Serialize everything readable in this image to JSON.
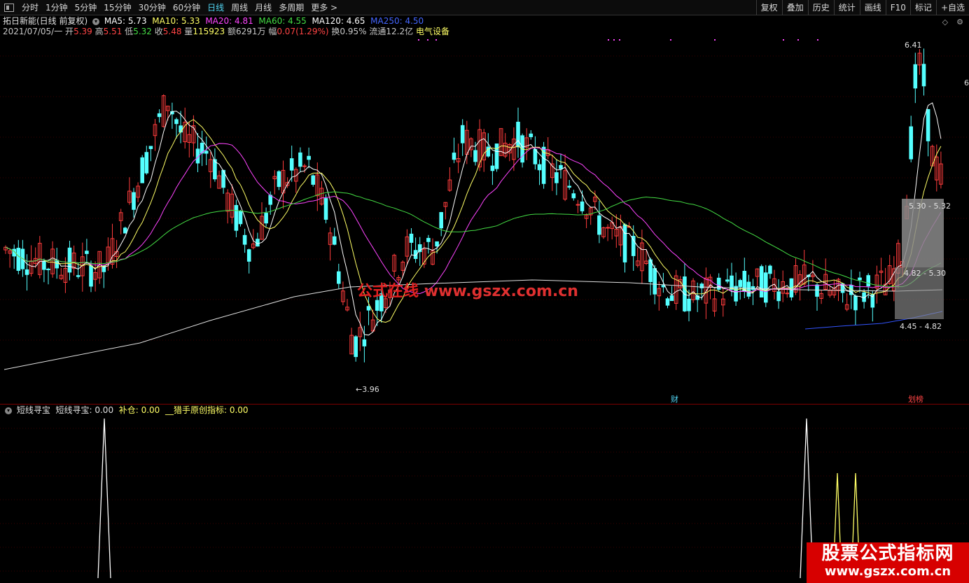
{
  "toolbar": {
    "periods": [
      "分时",
      "1分钟",
      "5分钟",
      "15分钟",
      "30分钟",
      "60分钟",
      "日线",
      "周线",
      "月线",
      "多周期",
      "更多 >"
    ],
    "active_period": "日线",
    "right_buttons": [
      "复权",
      "叠加",
      "历史",
      "统计",
      "画线",
      "F10",
      "标记",
      "+自选"
    ]
  },
  "stock": {
    "name": "拓日新能(日线 前复权)",
    "ma": [
      {
        "label": "MA5: 5.73",
        "color": "#ffffff"
      },
      {
        "label": "MA10: 5.33",
        "color": "#ffff66"
      },
      {
        "label": "MA20: 4.81",
        "color": "#ff44ff"
      },
      {
        "label": "MA60: 4.55",
        "color": "#44dd44"
      },
      {
        "label": "MA120: 4.65",
        "color": "#ffffff"
      },
      {
        "label": "MA250: 4.50",
        "color": "#4466ff"
      }
    ]
  },
  "quote": {
    "date": "2021/07/05/一",
    "open_label": "开",
    "open": "5.39",
    "high_label": "高",
    "high": "5.51",
    "low_label": "低",
    "low": "5.32",
    "close_label": "收",
    "close": "5.48",
    "vol_label": "量",
    "vol": "115923",
    "amt_label": "额",
    "amt": "6291万",
    "chg_label": "幅",
    "chg": "0.07(1.29%)",
    "turn_label": "换",
    "turn": "0.95%",
    "float_label": "流通",
    "float": "12.2亿",
    "sector": "电气设备"
  },
  "price_marks": {
    "high": "6.41",
    "low": "3.96",
    "band1": "5.30 - 5.32",
    "band2": "4.82 - 5.30",
    "band3": "4.45 - 4.82",
    "right_tick": "6"
  },
  "events": {
    "cai": "财",
    "bang": "划榜"
  },
  "indicator": {
    "name": "短线寻宝",
    "v1_label": "短线寻宝",
    "v1": "0.00",
    "v2_label": "补仓",
    "v2": "0.00",
    "v3_label": "猎手原创指标",
    "v3": "0.00"
  },
  "watermark": {
    "text": "公式在线",
    "url": "www.gszx.com.cn"
  },
  "banner": {
    "line1": "股票公式指标网",
    "line2": "www.gszx.com.cn"
  },
  "colors": {
    "up": "#ff3c3c",
    "down": "#54ffff",
    "ma5": "#ffffff",
    "ma10": "#ffff66",
    "ma20": "#ff44ff",
    "ma60": "#44dd44",
    "ma120": "#e0e0e0",
    "ma250": "#3355ff",
    "grid": "#3a0000"
  }
}
